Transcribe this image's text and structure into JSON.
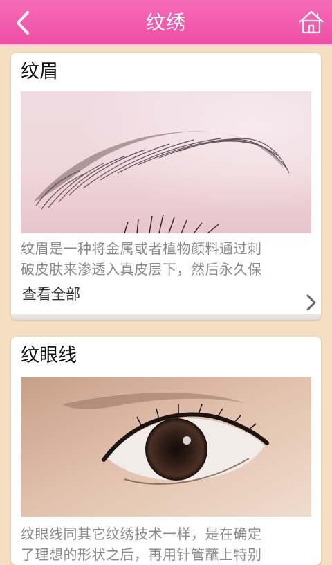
{
  "header": {
    "title": "纹绣",
    "accent_color": "#ee4fa5",
    "back_icon": "chevron-left-icon",
    "home_icon": "home-icon"
  },
  "cards": [
    {
      "title": "纹眉",
      "image": "eyebrow-photo",
      "description_line1": "纹眉是一种将金属或者植物颜料通过刺",
      "description_line2": "破皮肤来渗透入真皮层下，然后永久保",
      "view_all": "查看全部"
    },
    {
      "title": "纹眼线",
      "image": "eyeliner-photo",
      "description_line1": "纹眼线同其它纹绣技术一样，是在确定",
      "description_line2": "了理想的形状之后，再用针管蘸上特别"
    }
  ]
}
